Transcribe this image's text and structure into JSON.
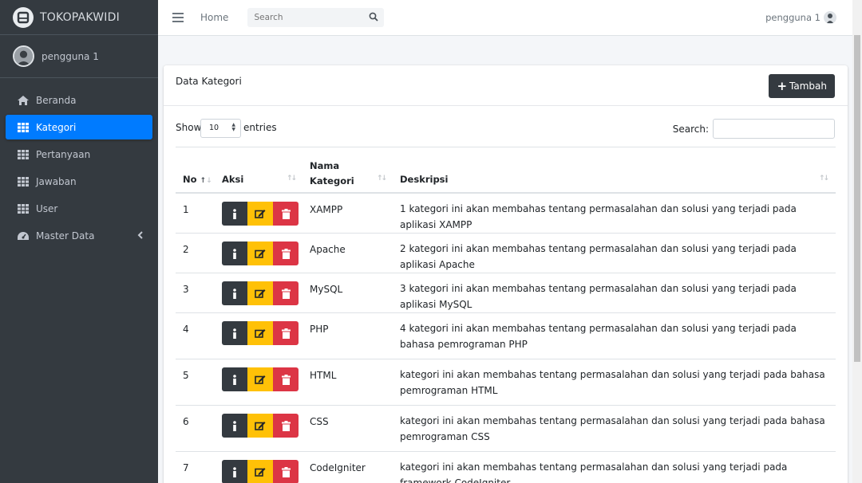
{
  "brand": {
    "title": "TOKOPAKWIDI"
  },
  "sidebar": {
    "user_name": "pengguna 1",
    "items": [
      {
        "label": "Beranda",
        "icon": "home-icon"
      },
      {
        "label": "Kategori",
        "icon": "grid-icon",
        "active": true
      },
      {
        "label": "Pertanyaan",
        "icon": "grid-icon"
      },
      {
        "label": "Jawaban",
        "icon": "grid-icon"
      },
      {
        "label": "User",
        "icon": "grid-icon"
      },
      {
        "label": "Master Data",
        "icon": "dashboard-icon"
      }
    ]
  },
  "topbar": {
    "home_label": "Home",
    "search_placeholder": "Search",
    "user_name": "pengguna 1"
  },
  "card": {
    "title": "Data Kategori",
    "add_button_label": "Tambah"
  },
  "table_controls": {
    "show_label": "Show",
    "page_length": "10",
    "entries_label": "entries",
    "search_label": "Search:"
  },
  "table": {
    "headers": {
      "no": "No",
      "aksi": "Aksi",
      "nama_line1": "Nama",
      "nama_line2": "Kategori",
      "deskripsi": "Deskripsi"
    },
    "rows": [
      {
        "no": "1",
        "name": "XAMPP",
        "desc": "1 kategori ini akan membahas tentang permasalahan dan solusi yang terjadi pada aplikasi XAMPP"
      },
      {
        "no": "2",
        "name": "Apache",
        "desc": "2 kategori ini akan membahas tentang permasalahan dan solusi yang terjadi pada aplikasi Apache"
      },
      {
        "no": "3",
        "name": "MySQL",
        "desc": "3 kategori ini akan membahas tentang permasalahan dan solusi yang terjadi pada aplikasi MySQL"
      },
      {
        "no": "4",
        "name": "PHP",
        "desc": "4 kategori ini akan membahas tentang permasalahan dan solusi yang terjadi pada bahasa pemrograman PHP"
      },
      {
        "no": "5",
        "name": "HTML",
        "desc": "kategori ini akan membahas tentang permasalahan dan solusi yang terjadi pada bahasa pemrograman HTML"
      },
      {
        "no": "6",
        "name": "CSS",
        "desc": "kategori ini akan membahas tentang permasalahan dan solusi yang terjadi pada bahasa pemrograman CSS"
      },
      {
        "no": "7",
        "name": "CodeIgniter",
        "desc": "kategori ini akan membahas tentang permasalahan dan solusi yang terjadi pada framework CodeIgniter"
      }
    ]
  },
  "colors": {
    "sidebar_bg": "#343a40",
    "active_nav": "#007bff",
    "btn_dark": "#343a40",
    "btn_warning": "#ffc107",
    "btn_danger": "#dc3545"
  }
}
